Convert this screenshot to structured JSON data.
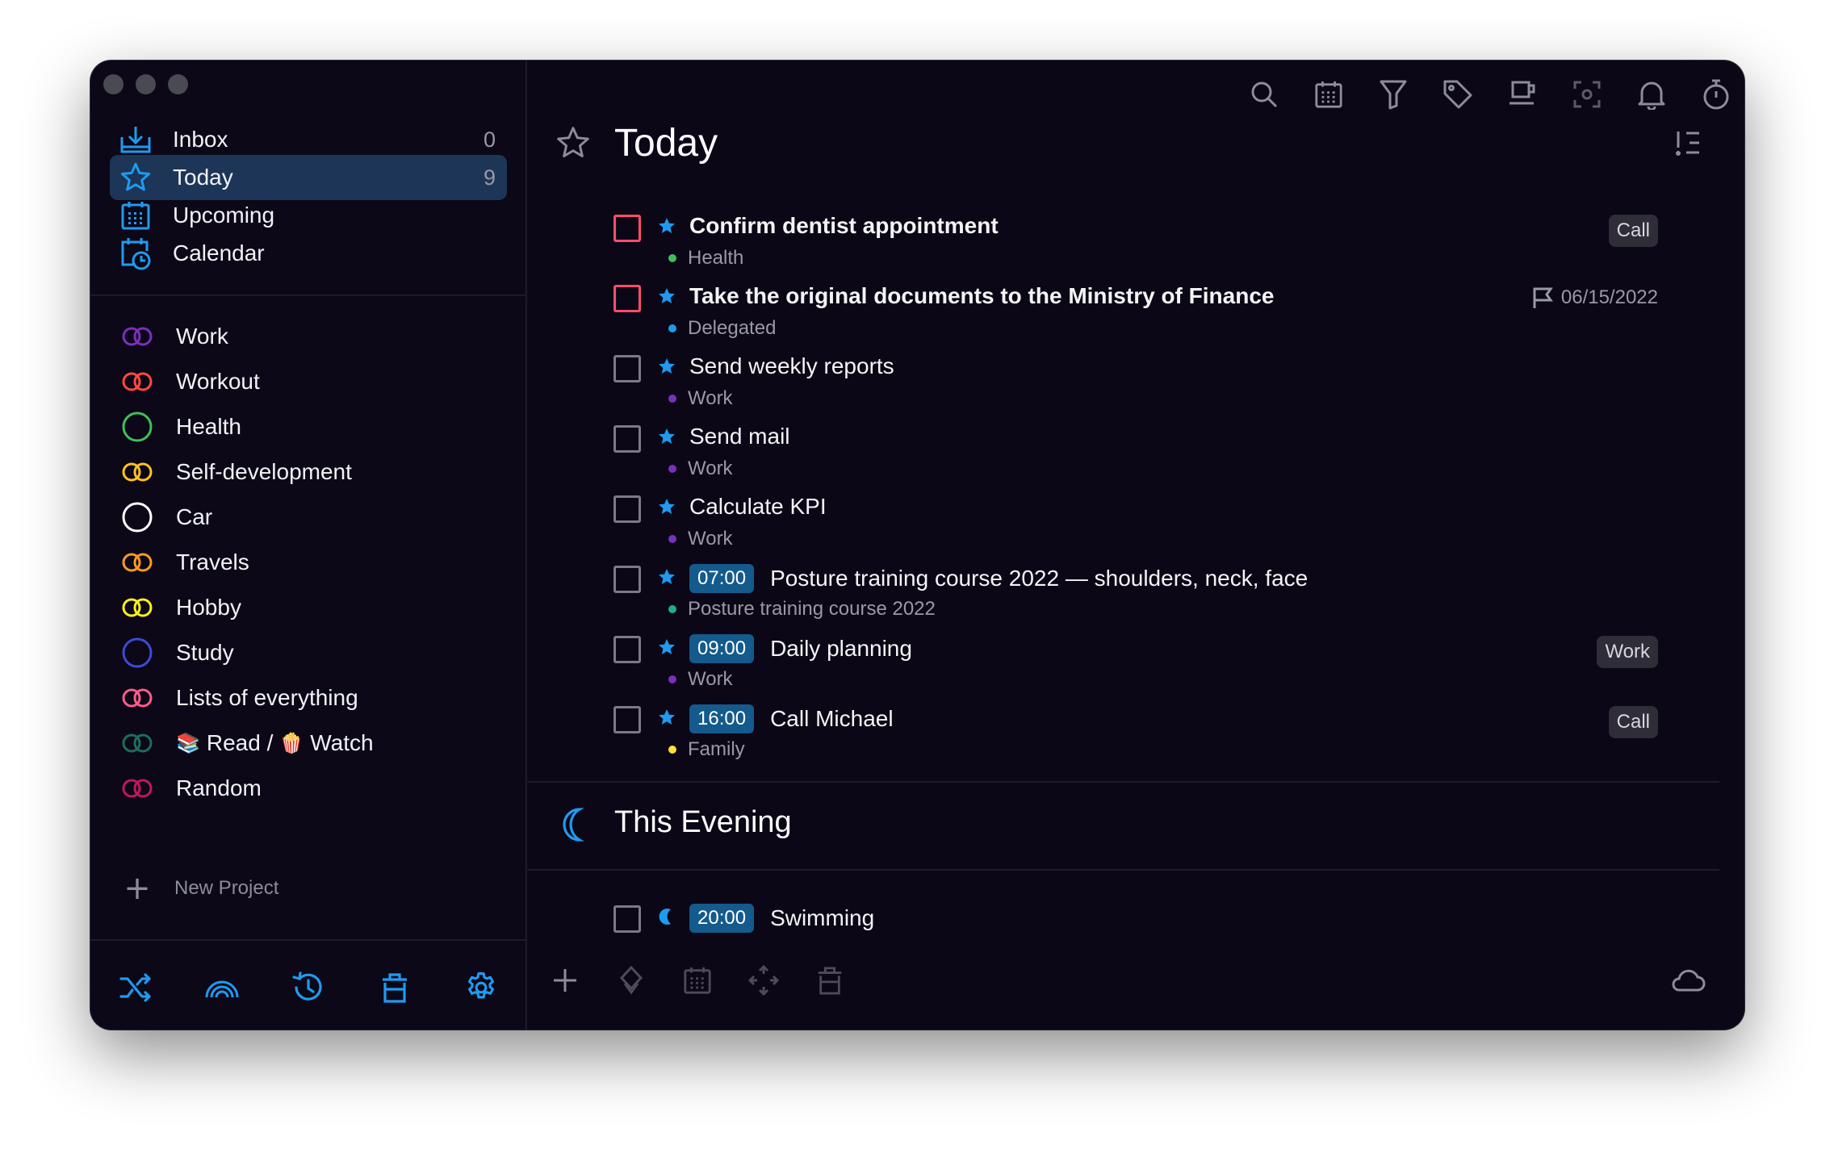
{
  "sidebar": {
    "nav": [
      {
        "label": "Inbox",
        "count": "0",
        "icon": "inbox-icon"
      },
      {
        "label": "Today",
        "count": "9",
        "icon": "star-icon"
      },
      {
        "label": "Upcoming",
        "count": "",
        "icon": "calendar-grid-icon"
      },
      {
        "label": "Calendar",
        "count": "",
        "icon": "calendar-clock-icon"
      }
    ],
    "projects": [
      {
        "label": "Work",
        "color": "#7b2fbe",
        "icon": "linked-rings-icon"
      },
      {
        "label": "Workout",
        "color": "#ff4a3d",
        "icon": "linked-rings-icon"
      },
      {
        "label": "Health",
        "color": "#3fbf5a",
        "icon": "circle-icon"
      },
      {
        "label": "Self-development",
        "color": "#ffc31f",
        "icon": "linked-rings-icon"
      },
      {
        "label": "Car",
        "color": "#ffffff",
        "icon": "circle-icon"
      },
      {
        "label": "Travels",
        "color": "#ff9a1f",
        "icon": "linked-rings-icon"
      },
      {
        "label": "Hobby",
        "color": "#fff01a",
        "icon": "linked-rings-icon"
      },
      {
        "label": "Study",
        "color": "#3b4bd6",
        "icon": "circle-icon"
      },
      {
        "label": "Lists of everything",
        "color": "#ff5c8a",
        "icon": "linked-rings-icon"
      },
      {
        "label": "Read /",
        "label2": "Watch",
        "emoji1": "📚",
        "emoji2": "🍿",
        "color": "#1d6e5a",
        "icon": "linked-rings-icon"
      },
      {
        "label": "Random",
        "color": "#c2185b",
        "icon": "linked-rings-icon"
      }
    ],
    "new_project": "New Project",
    "accent": "#1e9bf0"
  },
  "main": {
    "title": "Today",
    "tasks": [
      {
        "title": "Confirm dentist appointment",
        "project": "Health",
        "dot": "#3fbf5a",
        "bold": true,
        "urgent": true,
        "tag": "Call"
      },
      {
        "title": "Take the original documents to the Ministry of Finance",
        "project": "Delegated",
        "dot": "#1e9bf0",
        "bold": true,
        "urgent": true,
        "deadline": "06/15/2022"
      },
      {
        "title": "Send weekly reports",
        "project": "Work",
        "dot": "#7b2fbe"
      },
      {
        "title": "Send mail",
        "project": "Work",
        "dot": "#7b2fbe"
      },
      {
        "title": "Calculate KPI",
        "project": "Work",
        "dot": "#7b2fbe"
      },
      {
        "time": "07:00",
        "title": "Posture training course 2022 — shoulders, neck, face",
        "project": "Posture training course 2022",
        "dot": "#1fae8c"
      },
      {
        "time": "09:00",
        "title": "Daily planning",
        "project": "Work",
        "dot": "#7b2fbe",
        "tag": "Work"
      },
      {
        "time": "16:00",
        "title": "Call Michael",
        "project": "Family",
        "dot": "#ffe033",
        "tag": "Call"
      }
    ],
    "evening": {
      "title": "This Evening",
      "tasks": [
        {
          "time": "20:00",
          "title": "Swimming"
        }
      ]
    }
  }
}
